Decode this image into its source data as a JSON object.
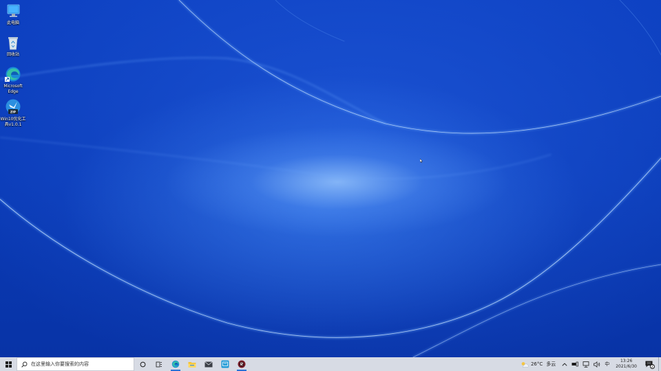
{
  "desktop": {
    "icons": [
      {
        "label": "此电脑",
        "icon": "this-pc-icon"
      },
      {
        "label": "回收站",
        "icon": "recycle-bin-icon"
      },
      {
        "label": "Microsoft Edge",
        "icon": "edge-icon"
      },
      {
        "label": "Win10优化工具v1.0.1",
        "icon": "zip-tool-icon"
      }
    ]
  },
  "taskbar": {
    "search_placeholder": "在这里输入你要搜索的内容",
    "pinned": [
      "cortana-icon",
      "task-view-icon",
      "edge-icon",
      "file-explorer-icon",
      "mail-icon",
      "store-icon",
      "app-icon"
    ],
    "weather": {
      "temp": "26°C",
      "condition": "多云"
    },
    "ime": "中",
    "clock": {
      "time": "13:26",
      "date": "2021/6/30"
    },
    "notification_count": "2"
  },
  "colors": {
    "accent": "#2a73d8",
    "taskbar_bg": "#d7dbe4",
    "wallpaper": "#0a3bb8"
  }
}
